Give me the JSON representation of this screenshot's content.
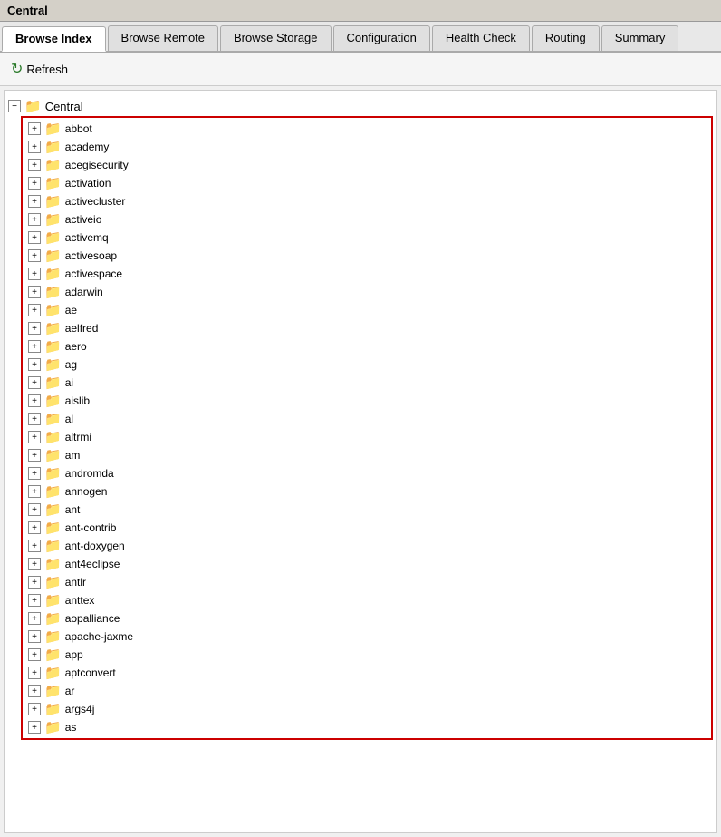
{
  "window": {
    "title": "Central"
  },
  "tabs": [
    {
      "id": "browse-index",
      "label": "Browse Index",
      "active": true
    },
    {
      "id": "browse-remote",
      "label": "Browse Remote",
      "active": false
    },
    {
      "id": "browse-storage",
      "label": "Browse Storage",
      "active": false
    },
    {
      "id": "configuration",
      "label": "Configuration",
      "active": false
    },
    {
      "id": "health-check",
      "label": "Health Check",
      "active": false
    },
    {
      "id": "routing",
      "label": "Routing",
      "active": false
    },
    {
      "id": "summary",
      "label": "Summary",
      "active": false
    }
  ],
  "toolbar": {
    "refresh_label": "Refresh"
  },
  "tree": {
    "root_label": "Central",
    "items": [
      "abbot",
      "academy",
      "acegisecurity",
      "activation",
      "activecluster",
      "activeio",
      "activemq",
      "activesoap",
      "activespace",
      "adarwin",
      "ae",
      "aelfred",
      "aero",
      "ag",
      "ai",
      "aislib",
      "al",
      "altrmi",
      "am",
      "andromda",
      "annogen",
      "ant",
      "ant-contrib",
      "ant-doxygen",
      "ant4eclipse",
      "antlr",
      "anttex",
      "aopalliance",
      "apache-jaxme",
      "app",
      "aptconvert",
      "ar",
      "args4j",
      "as"
    ]
  }
}
